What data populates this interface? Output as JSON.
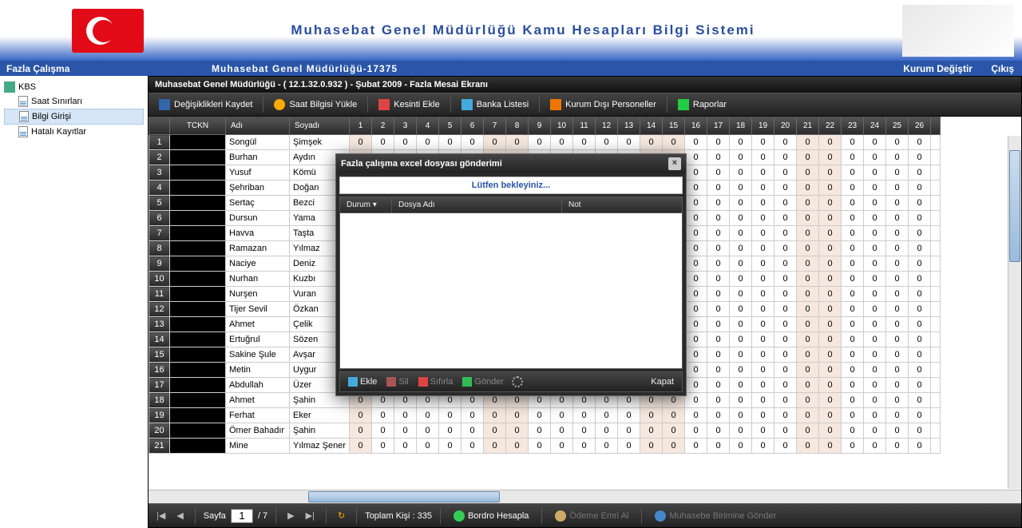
{
  "banner": {
    "title": "Muhasebat Genel Müdürlüğü Kamu Hesapları Bilgi Sistemi"
  },
  "bluebar": {
    "left": "Fazla Çalışma",
    "center": "Muhasebat Genel Müdürlüğü-17375",
    "change": "Kurum Değiştir",
    "exit": "Çıkış"
  },
  "tree": {
    "root": "KBS",
    "items": [
      "Saat Sınırları",
      "Bilgi Girişi",
      "Hatalı Kayıtlar"
    ],
    "selected": 1
  },
  "content": {
    "title": "Muhasebat Genel Müdürlüğü - ( 12.1.32.0.932 ) - Şubat 2009 - Fazla Mesai Ekranı"
  },
  "toolbar": {
    "save": "Değişiklikleri Kaydet",
    "upload": "Saat Bilgisi Yükle",
    "cut": "Kesinti Ekle",
    "bank": "Banka Listesi",
    "external": "Kurum Dışı Personeller",
    "reports": "Raporlar"
  },
  "grid": {
    "headers": {
      "tckn": "TCKN",
      "name": "Adı",
      "surname": "Soyadı"
    },
    "day_cols": [
      1,
      2,
      3,
      4,
      5,
      6,
      7,
      8,
      9,
      10,
      11,
      12,
      13,
      14,
      15,
      16,
      17,
      18,
      19,
      20,
      21,
      22,
      23,
      24,
      25,
      26
    ],
    "holiday_cols": [
      1,
      7,
      8,
      14,
      15,
      21,
      22
    ],
    "rows": [
      {
        "n": 1,
        "name": "Songül",
        "surname": "Şimşek"
      },
      {
        "n": 2,
        "name": "Burhan",
        "surname": "Aydın"
      },
      {
        "n": 3,
        "name": "Yusuf",
        "surname": "Kömü"
      },
      {
        "n": 4,
        "name": "Şehriban",
        "surname": "Doğan"
      },
      {
        "n": 5,
        "name": "Sertaç",
        "surname": "Bezci"
      },
      {
        "n": 6,
        "name": "Dursun",
        "surname": "Yama"
      },
      {
        "n": 7,
        "name": "Havva",
        "surname": "Taşta"
      },
      {
        "n": 8,
        "name": "Ramazan",
        "surname": "Yılmaz"
      },
      {
        "n": 9,
        "name": "Naciye",
        "surname": "Deniz"
      },
      {
        "n": 10,
        "name": "Nurhan",
        "surname": "Kuzbı"
      },
      {
        "n": 11,
        "name": "Nurşen",
        "surname": "Vuran"
      },
      {
        "n": 12,
        "name": "Tijer Sevil",
        "surname": "Özkan"
      },
      {
        "n": 13,
        "name": "Ahmet",
        "surname": "Çelik"
      },
      {
        "n": 14,
        "name": "Ertuğrul",
        "surname": "Sözen"
      },
      {
        "n": 15,
        "name": "Sakine Şule",
        "surname": "Avşar"
      },
      {
        "n": 16,
        "name": "Metin",
        "surname": "Uygur"
      },
      {
        "n": 17,
        "name": "Abdullah",
        "surname": "Üzer"
      },
      {
        "n": 18,
        "name": "Ahmet",
        "surname": "Şahin"
      },
      {
        "n": 19,
        "name": "Ferhat",
        "surname": "Eker"
      },
      {
        "n": 20,
        "name": "Ömer Bahadır",
        "surname": "Şahin"
      },
      {
        "n": 21,
        "name": "Mine",
        "surname": "Yılmaz Şener"
      }
    ],
    "cell_value": "0"
  },
  "footer": {
    "page_label": "Sayfa",
    "page_current": "1",
    "page_total": "/ 7",
    "total_persons": "Toplam Kişi : 335",
    "payroll": "Bordro Hesapla",
    "payment_order": "Ödeme Emri Al",
    "send_accounting": "Muhasebe Birimine Gönder"
  },
  "modal": {
    "title": "Fazla çalışma excel dosyası gönderimi",
    "wait_msg": "Lütfen bekleyiniz...",
    "cols": {
      "status": "Durum",
      "filename": "Dosya Adı",
      "note": "Not"
    },
    "btns": {
      "add": "Ekle",
      "del": "Sil",
      "reset": "Sıfırla",
      "send": "Gönder",
      "close": "Kapat"
    }
  }
}
